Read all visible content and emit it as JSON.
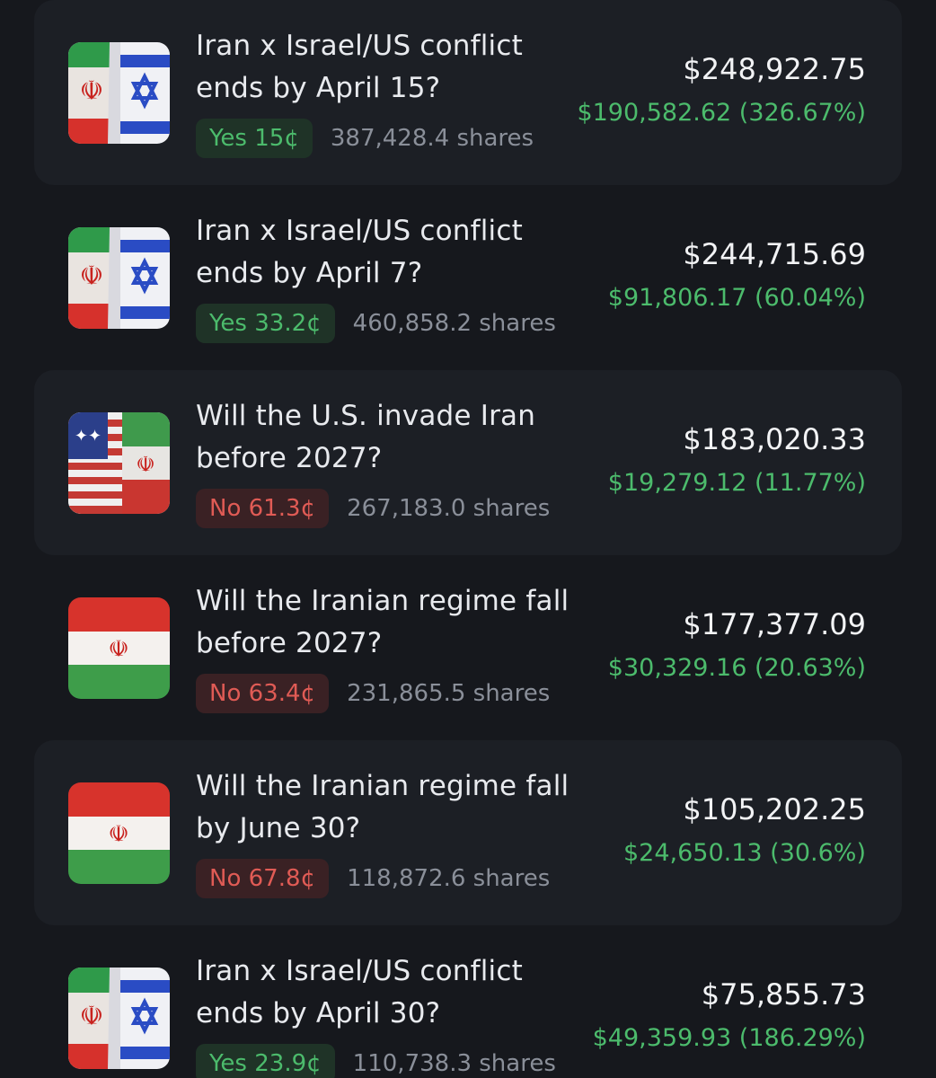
{
  "positions": [
    {
      "title": "Iran x Israel/US conflict ends by April 15?",
      "outcome": "Yes 15¢",
      "outcome_side": "yes",
      "shares": "387,428.4 shares",
      "value": "$248,922.75",
      "pnl": "$190,582.62 (326.67%)",
      "icon": "iran-israel-flag-icon"
    },
    {
      "title": "Iran x Israel/US conflict ends by April 7?",
      "outcome": "Yes 33.2¢",
      "outcome_side": "yes",
      "shares": "460,858.2 shares",
      "value": "$244,715.69",
      "pnl": "$91,806.17 (60.04%)",
      "icon": "iran-israel-flag-icon"
    },
    {
      "title": "Will the U.S. invade Iran before 2027?",
      "outcome": "No 61.3¢",
      "outcome_side": "no",
      "shares": "267,183.0 shares",
      "value": "$183,020.33",
      "pnl": "$19,279.12 (11.77%)",
      "icon": "usa-iran-flag-icon"
    },
    {
      "title": "Will the Iranian regime fall before 2027?",
      "outcome": "No 63.4¢",
      "outcome_side": "no",
      "shares": "231,865.5 shares",
      "value": "$177,377.09",
      "pnl": "$30,329.16 (20.63%)",
      "icon": "iran-flag-icon"
    },
    {
      "title": "Will the Iranian regime fall by June 30?",
      "outcome": "No 67.8¢",
      "outcome_side": "no",
      "shares": "118,872.6 shares",
      "value": "$105,202.25",
      "pnl": "$24,650.13 (30.6%)",
      "icon": "iran-flag-icon"
    },
    {
      "title": "Iran x Israel/US conflict ends by April 30?",
      "outcome": "Yes 23.9¢",
      "outcome_side": "yes",
      "shares": "110,738.3 shares",
      "value": "$75,855.73",
      "pnl": "$49,359.93 (186.29%)",
      "icon": "iran-israel-flag-icon"
    }
  ],
  "colors": {
    "background": "#16181d",
    "card_alt": "#1c1f25",
    "yes_green": "#4cbb6c",
    "no_red": "#e05b55",
    "text_primary": "#e8eaee",
    "text_muted": "#8a8f99"
  }
}
